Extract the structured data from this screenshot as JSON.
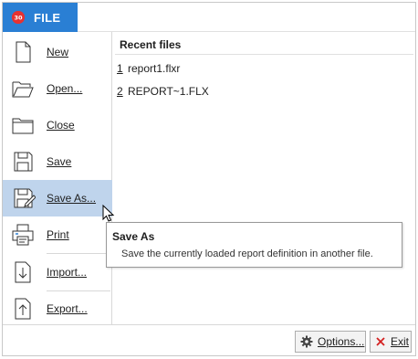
{
  "header": {
    "tab_label": "FILE",
    "logo_text": "30",
    "accent_color": "#2a7fd4",
    "logo_color": "#e63232"
  },
  "menu": {
    "items": [
      {
        "label": "New",
        "icon": "new-document-icon"
      },
      {
        "label": "Open...",
        "icon": "open-folder-icon"
      },
      {
        "label": "Close",
        "icon": "close-folder-icon"
      },
      {
        "label": "Save",
        "icon": "save-icon"
      },
      {
        "label": "Save As...",
        "icon": "save-as-icon",
        "active": true
      },
      {
        "label": "Print",
        "icon": "printer-icon"
      },
      {
        "label": "Import...",
        "icon": "import-icon"
      },
      {
        "label": "Export...",
        "icon": "export-icon"
      }
    ],
    "active_color": "#bfd4ec"
  },
  "recent": {
    "title": "Recent files",
    "files": [
      {
        "num": "1",
        "name": "report1.flxr"
      },
      {
        "num": "2",
        "name": "REPORT~1.FLX"
      }
    ]
  },
  "tooltip": {
    "title": "Save As",
    "body": "Save the currently loaded report definition in another file."
  },
  "footer": {
    "options_label": "Options...",
    "options_icon": "gear-icon",
    "exit_label": "Exit",
    "exit_icon": "close-x-icon",
    "exit_icon_color": "#d32020"
  }
}
